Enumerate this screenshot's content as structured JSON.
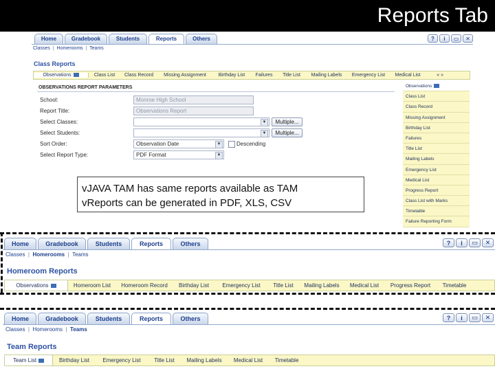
{
  "slide": {
    "title": "Reports Tab"
  },
  "callout": {
    "bullet": "v",
    "lines": [
      "JAVA TAM has same reports available as TAM",
      "Reports can be generated in PDF, XLS, CSV"
    ]
  },
  "nav": {
    "tabs": [
      "Home",
      "Gradebook",
      "Students",
      "Reports",
      "Others"
    ],
    "active_tab": "Reports",
    "icons": [
      "help-icon",
      "info-icon",
      "window-icon",
      "close-icon"
    ]
  },
  "panel1": {
    "subnav": [
      "Classes",
      "Homerooms",
      "Teams"
    ],
    "section_title": "Class Reports",
    "report_tabs": [
      "Observations",
      "Class List",
      "Class Record",
      "Missing Assignment",
      "Birthday List",
      "Failures",
      "Title List",
      "Mailing Labels",
      "Emergency List",
      "Medical List"
    ],
    "scroll_arrows": "«  »",
    "params_heading": "OBSERVATIONS REPORT PARAMETERS",
    "params": [
      {
        "label": "School:",
        "value": "Monroe High School",
        "type": "readonly"
      },
      {
        "label": "Report Title:",
        "value": "Observations Report",
        "type": "readonly"
      },
      {
        "label": "Select Classes:",
        "value": "",
        "type": "select",
        "button": "Multiple..."
      },
      {
        "label": "Select Students:",
        "value": "",
        "type": "select",
        "button": "Multiple..."
      },
      {
        "label": "Sort Order:",
        "value": "Observation Date",
        "type": "select",
        "checkbox": "Descending"
      },
      {
        "label": "Select Report Type:",
        "value": "PDF Format",
        "type": "select"
      }
    ],
    "side_list": [
      "Observations",
      "Class List",
      "Class Record",
      "Missing Assignment",
      "Birthday List",
      "Failures",
      "Title List",
      "Mailing Labels",
      "Emergency List",
      "Medical List",
      "Progress Report",
      "Class List with Marks",
      "Timetable",
      "Failure Reporting Form"
    ]
  },
  "panel2": {
    "subnav": [
      "Classes",
      "Homerooms",
      "Teams"
    ],
    "section_title": "Homeroom Reports",
    "report_tabs": [
      "Observations",
      "Homeroom List",
      "Homeroom Record",
      "Birthday List",
      "Emergency List",
      "Title List",
      "Mailing Labels",
      "Medical List",
      "Progress Report",
      "Timetable"
    ]
  },
  "panel3": {
    "subnav": [
      "Classes",
      "Homerooms",
      "Teams"
    ],
    "section_title": "Team Reports",
    "report_tabs": [
      "Team List",
      "Birthday List",
      "Emergency List",
      "Title List",
      "Mailing Labels",
      "Medical List",
      "Timetable"
    ]
  }
}
